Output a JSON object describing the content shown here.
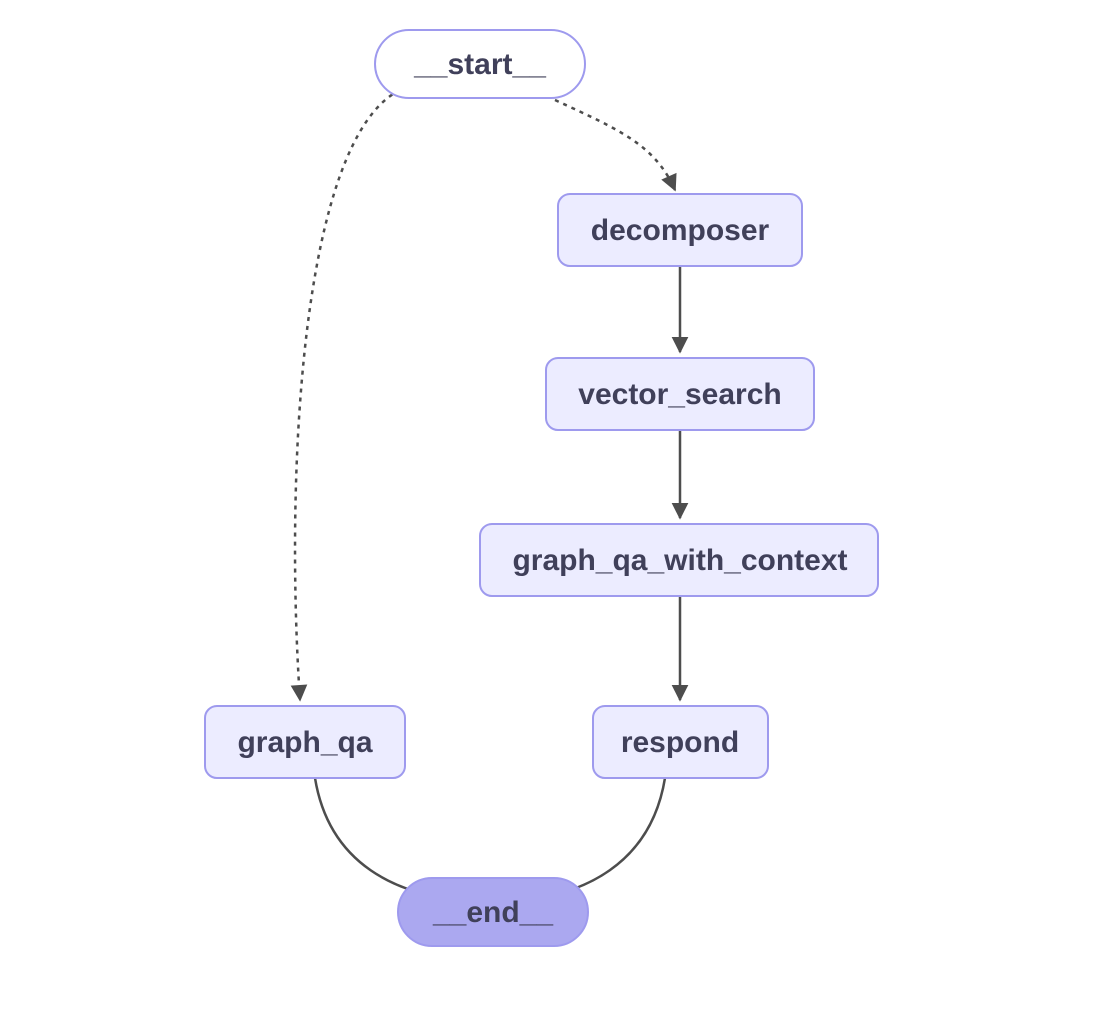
{
  "nodes": {
    "start": {
      "label": "__start__"
    },
    "decomposer": {
      "label": "decomposer"
    },
    "vector_search": {
      "label": "vector_search"
    },
    "graph_qa_with_context": {
      "label": "graph_qa_with_context"
    },
    "graph_qa": {
      "label": "graph_qa"
    },
    "respond": {
      "label": "respond"
    },
    "end": {
      "label": "__end__"
    }
  },
  "edges": [
    {
      "from": "start",
      "to": "decomposer",
      "style": "dotted",
      "arrow": true
    },
    {
      "from": "start",
      "to": "graph_qa",
      "style": "dotted",
      "arrow": true
    },
    {
      "from": "decomposer",
      "to": "vector_search",
      "style": "solid",
      "arrow": true
    },
    {
      "from": "vector_search",
      "to": "graph_qa_with_context",
      "style": "solid",
      "arrow": true
    },
    {
      "from": "graph_qa_with_context",
      "to": "respond",
      "style": "solid",
      "arrow": true
    },
    {
      "from": "graph_qa",
      "to": "end",
      "style": "solid",
      "arrow": true
    },
    {
      "from": "respond",
      "to": "end",
      "style": "solid",
      "arrow": true
    }
  ],
  "colors": {
    "node_fill": "#ECECFF",
    "node_stroke": "#9E9AEE",
    "end_fill": "#ABA8F0",
    "edge": "#4d4d4d",
    "text": "#40405a"
  }
}
